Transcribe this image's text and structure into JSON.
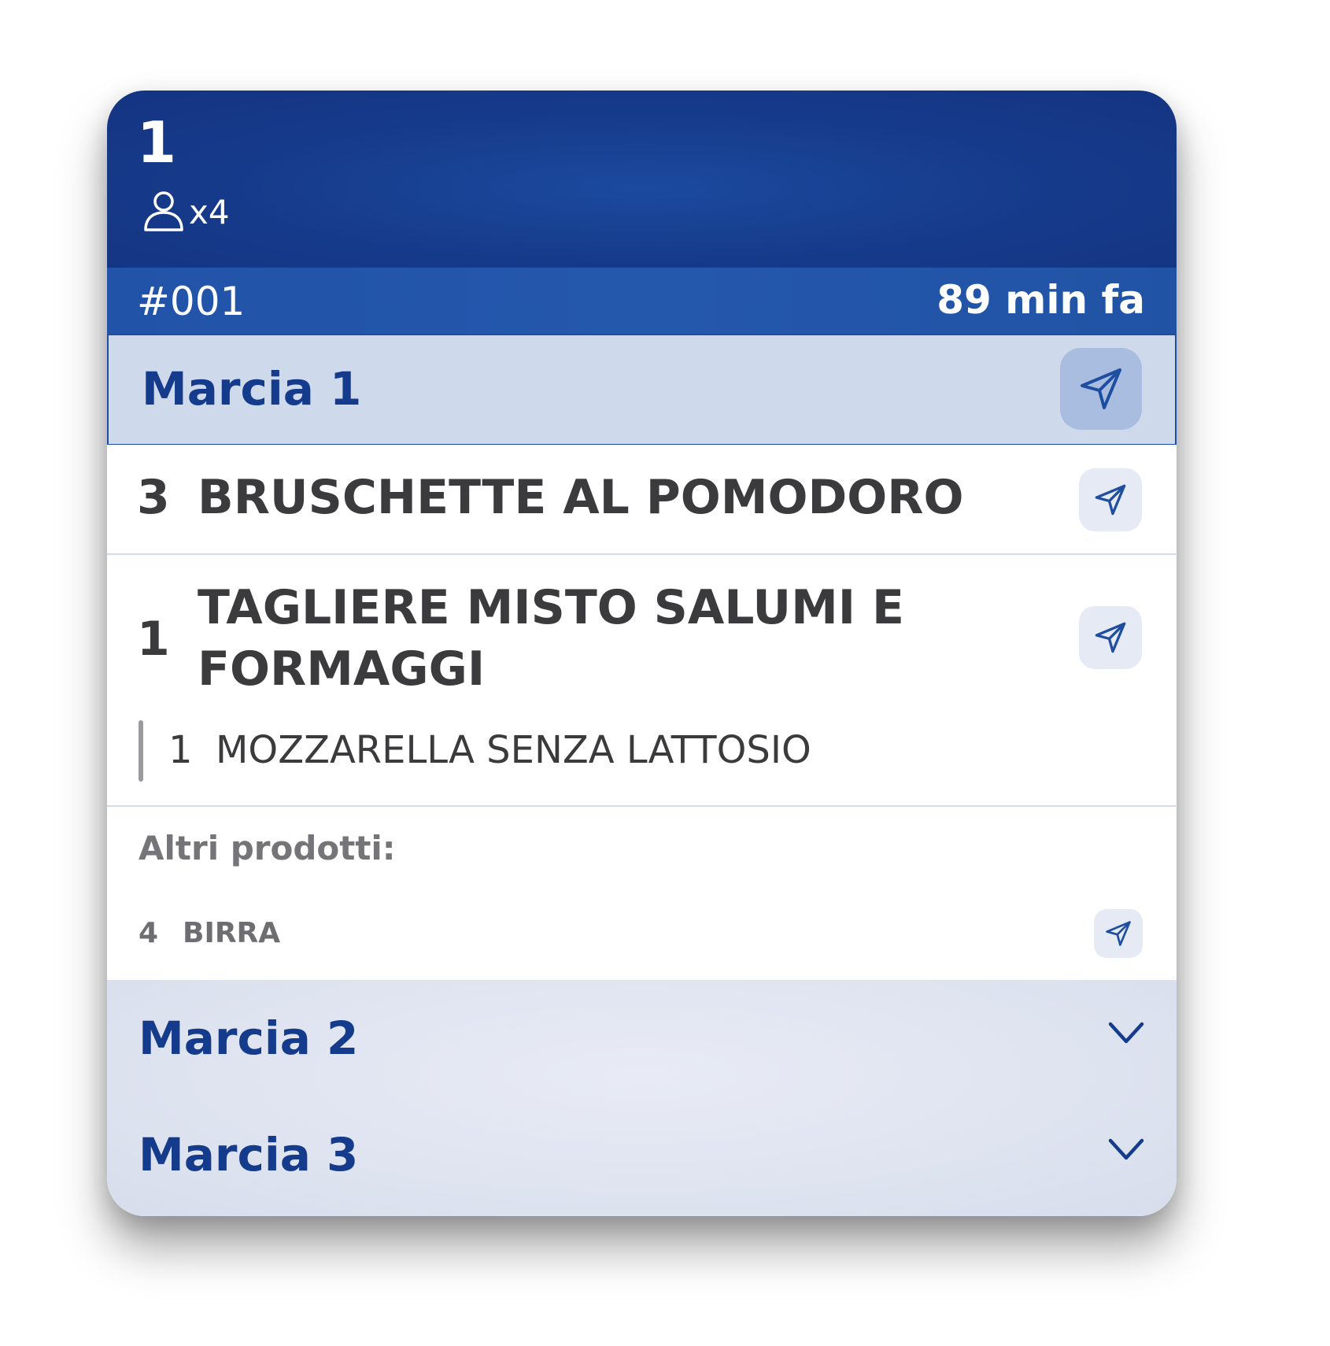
{
  "ticket": {
    "table_number": "1",
    "guests_label": "x4",
    "order_number": "#001",
    "elapsed": "89 min fa"
  },
  "courses": [
    {
      "title": "Marcia 1",
      "state": "expanded",
      "items": [
        {
          "qty": "3",
          "name": "BRUSCHETTE AL POMODORO"
        },
        {
          "qty": "1",
          "name_line1": "TAGLIERE MISTO SALUMI E",
          "name_line2": "FORMAGGI",
          "modifiers": [
            {
              "qty": "1",
              "name": "MOZZARELLA SENZA LATTOSIO"
            }
          ]
        }
      ],
      "other_products_label": "Altri prodotti:",
      "other_products": [
        {
          "qty": "4",
          "name": "BIRRA"
        }
      ]
    },
    {
      "title": "Marcia 2",
      "state": "collapsed"
    },
    {
      "title": "Marcia 3",
      "state": "collapsed"
    }
  ],
  "icons": {
    "guests": "person-icon",
    "send": "paper-plane-icon",
    "expand": "chevron-down-icon"
  },
  "colors": {
    "header_blue": "#163a8a",
    "accent_blue": "#143b8c",
    "active_course_bg": "#cfd9ec",
    "item_text": "#3b3b3e"
  }
}
